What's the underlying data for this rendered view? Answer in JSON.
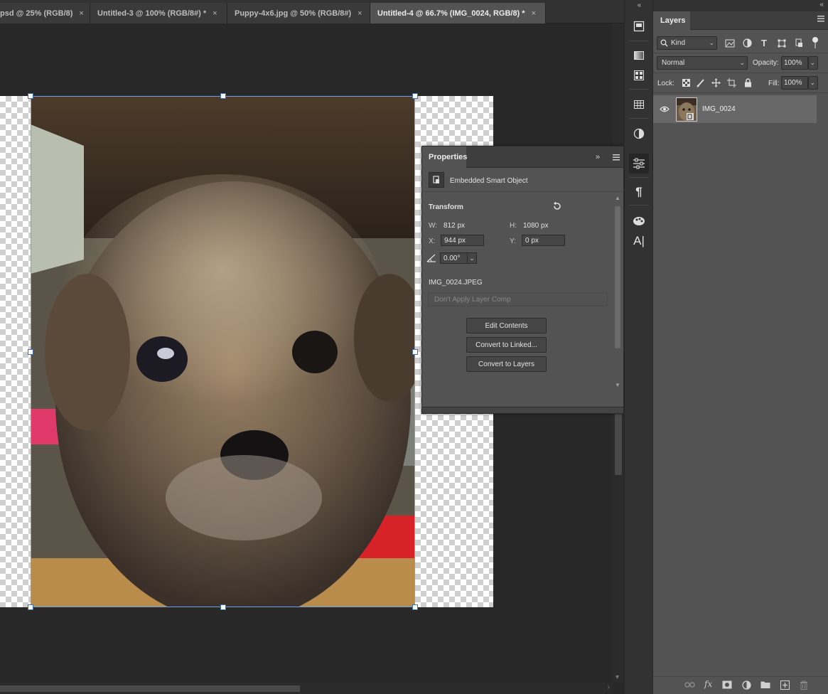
{
  "tabs": [
    {
      "label": "psd @ 25% (RGB/8)",
      "active": false
    },
    {
      "label": "Untitled-3 @ 100% (RGB/8#) *",
      "active": false
    },
    {
      "label": "Puppy-4x6.jpg @ 50% (RGB/8#)",
      "active": false
    },
    {
      "label": "Untitled-4 @ 66.7% (IMG_0024, RGB/8) *",
      "active": true
    }
  ],
  "tab_close_glyph": "×",
  "icon_strip": {
    "collapse": "«",
    "items": [
      "history-icon",
      "gradient-icon",
      "swatches-icon",
      "grid-icon",
      "adjustments-icon",
      "properties-icon",
      "paragraph-icon",
      "brush-icon",
      "character-icon"
    ]
  },
  "layers_panel": {
    "title": "Layers",
    "collapse": "«",
    "filter_kind": "Kind",
    "blend_mode": "Normal",
    "opacity_label": "Opacity:",
    "opacity_value": "100%",
    "lock_label": "Lock:",
    "fill_label": "Fill:",
    "fill_value": "100%",
    "layers": [
      {
        "name": "IMG_0024",
        "visible": true,
        "type": "smart-object"
      }
    ],
    "bottom_icons": [
      "link-icon",
      "fx-icon",
      "mask-icon",
      "adjustment-layer-icon",
      "folder-icon",
      "new-layer-icon",
      "trash-icon"
    ]
  },
  "properties_panel": {
    "title": "Properties",
    "collapse": "»",
    "object_type": "Embedded Smart Object",
    "section": "Transform",
    "w_label": "W:",
    "w_value": "812 px",
    "h_label": "H:",
    "h_value": "1080 px",
    "x_label": "X:",
    "x_value": "944 px",
    "y_label": "Y:",
    "y_value": "0 px",
    "angle_value": "0.00°",
    "filename": "IMG_0024.JPEG",
    "layer_comp": "Don't Apply Layer Comp",
    "buttons": [
      "Edit Contents",
      "Convert to Linked...",
      "Convert to Layers"
    ]
  },
  "colors": {
    "accent": "#6da2e8",
    "panel_bg": "#535353",
    "workspace": "#282828"
  }
}
